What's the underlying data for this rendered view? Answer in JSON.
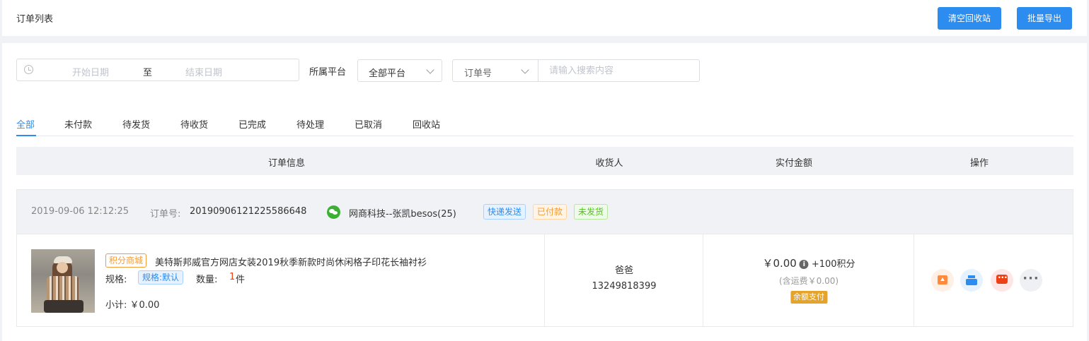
{
  "header": {
    "title": "订单列表",
    "clear_recycle_label": "清空回收站",
    "batch_export_label": "批量导出"
  },
  "filters": {
    "start_date_placeholder": "开始日期",
    "date_separator": "至",
    "end_date_placeholder": "结束日期",
    "platform_label": "所属平台",
    "platform_value": "全部平台",
    "search_field_value": "订单号",
    "search_placeholder": "请输入搜索内容"
  },
  "tabs": [
    {
      "label": "全部",
      "active": true
    },
    {
      "label": "未付款"
    },
    {
      "label": "待发货"
    },
    {
      "label": "待收货"
    },
    {
      "label": "已完成"
    },
    {
      "label": "待处理"
    },
    {
      "label": "已取消"
    },
    {
      "label": "回收站"
    }
  ],
  "table": {
    "columns": [
      "订单信息",
      "收货人",
      "实付金额",
      "操作"
    ]
  },
  "orders": [
    {
      "time": "2019-09-06 12:12:25",
      "order_no_label": "订单号:",
      "order_no": "20190906121225586648",
      "shop": "网商科技--张凯besos(25)",
      "tags": [
        "快递发送",
        "已付款",
        "未发货"
      ],
      "product": {
        "source_tag": "积分商城",
        "name": "美特斯邦威官方网店女装2019秋季新款时尚休闲格子印花长袖衬衫",
        "spec_label": "规格:",
        "spec_value": "规格:默认",
        "qty_label": "数量:",
        "qty": "1",
        "qty_unit": "件",
        "subtotal": "小计: ￥0.00"
      },
      "receiver": {
        "name": "爸爸",
        "phone": "13249818399"
      },
      "payment": {
        "amount": "￥0.00",
        "points": "+100积分",
        "shipping": "(含运费￥0.00)",
        "method": "余额支付"
      }
    }
  ],
  "colors": {
    "primary": "#2d8cf0",
    "warning": "#f29c38",
    "success": "#52c41a",
    "danger": "#ed4014"
  },
  "icons": [
    "clock-icon",
    "chevron-down-icon",
    "wechat-icon",
    "info-icon",
    "ship-icon",
    "print-icon",
    "message-icon",
    "more-icon"
  ]
}
